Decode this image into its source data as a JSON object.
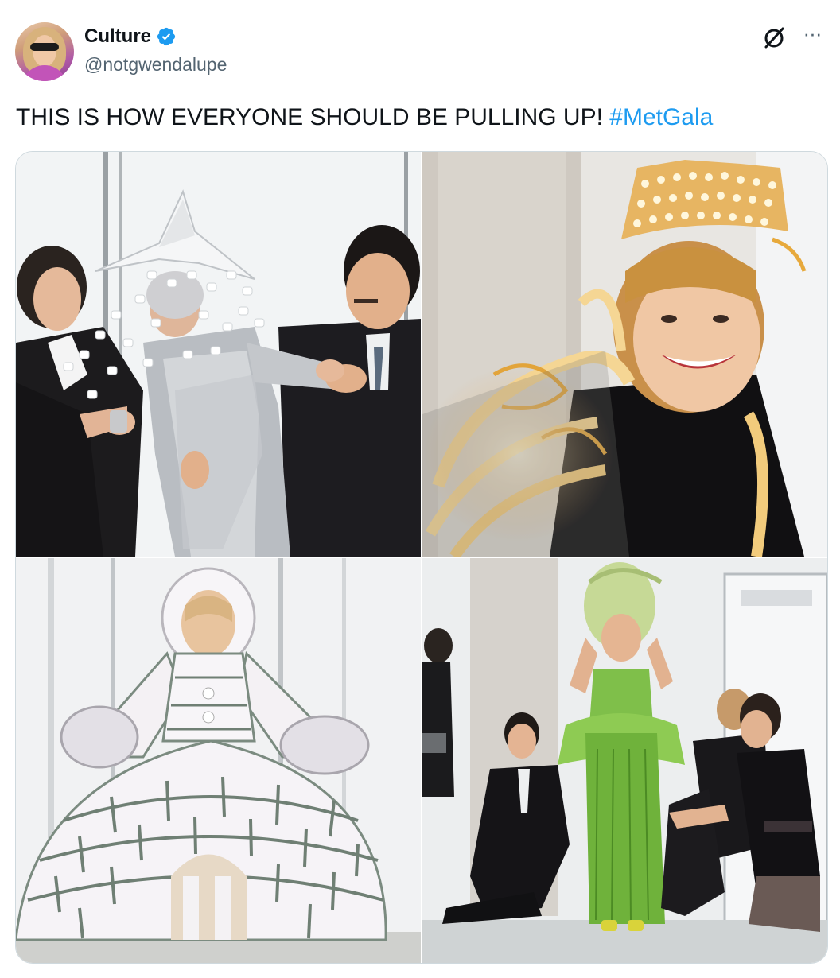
{
  "author": {
    "display_name": "Culture",
    "handle": "@notgwendalupe",
    "verified": true,
    "avatar_icon": "profile-avatar"
  },
  "actions": {
    "grok_icon": "grok-icon",
    "more_icon": "more-options-icon",
    "more_glyph": "···"
  },
  "tweet": {
    "text": "THIS IS HOW EVERYONE SHOULD BE PULLING UP! ",
    "hashtag": "#MetGala"
  },
  "media": {
    "images": [
      {
        "description_icon": "silver-dress-photo"
      },
      {
        "description_icon": "light-crown-photo"
      },
      {
        "description_icon": "igloo-dress-photo"
      },
      {
        "description_icon": "green-gown-photo"
      }
    ]
  },
  "colors": {
    "link": "#1d9bf0",
    "verified": "#1d9bf0",
    "secondary_text": "#536471",
    "border": "#cfd9de"
  }
}
